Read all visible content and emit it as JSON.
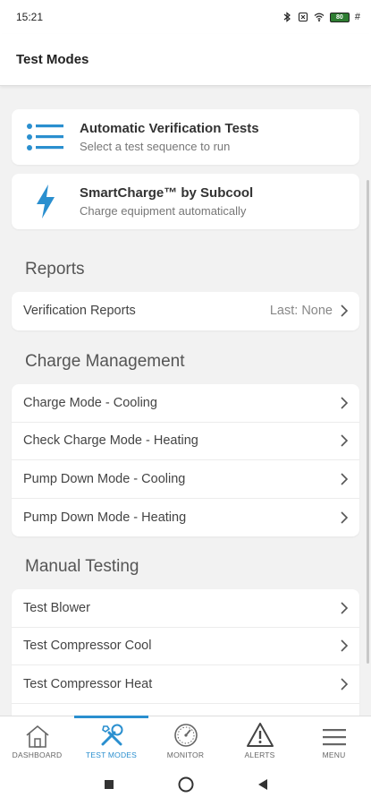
{
  "status_bar": {
    "time": "15:21",
    "battery_label": "80",
    "extra": "#"
  },
  "header": {
    "title": "Test Modes"
  },
  "features": [
    {
      "title": "Automatic Verification Tests",
      "subtitle": "Select a test sequence to run",
      "icon": "list-icon"
    },
    {
      "title": "SmartCharge™ by Subcool",
      "subtitle": "Charge equipment automatically",
      "icon": "lightning-icon"
    }
  ],
  "reports": {
    "title": "Reports",
    "items": [
      {
        "label": "Verification Reports",
        "value": "Last: None"
      }
    ]
  },
  "charge_management": {
    "title": "Charge Management",
    "items": [
      {
        "label": "Charge Mode - Cooling"
      },
      {
        "label": "Check Charge Mode - Heating"
      },
      {
        "label": "Pump Down Mode - Cooling"
      },
      {
        "label": "Pump Down Mode - Heating"
      }
    ]
  },
  "manual_testing": {
    "title": "Manual Testing",
    "items": [
      {
        "label": "Test Blower"
      },
      {
        "label": "Test Compressor Cool"
      },
      {
        "label": "Test Compressor Heat"
      }
    ]
  },
  "bottom_nav": [
    {
      "label": "DASHBOARD",
      "icon": "home-icon",
      "active": false
    },
    {
      "label": "TEST MODES",
      "icon": "tools-icon",
      "active": true
    },
    {
      "label": "MONITOR",
      "icon": "gauge-icon",
      "active": false
    },
    {
      "label": "ALERTS",
      "icon": "alert-icon",
      "active": false
    },
    {
      "label": "MENU",
      "icon": "menu-icon",
      "active": false
    }
  ],
  "colors": {
    "accent": "#2a8fcf",
    "background": "#f2f2f2",
    "card": "#ffffff"
  }
}
